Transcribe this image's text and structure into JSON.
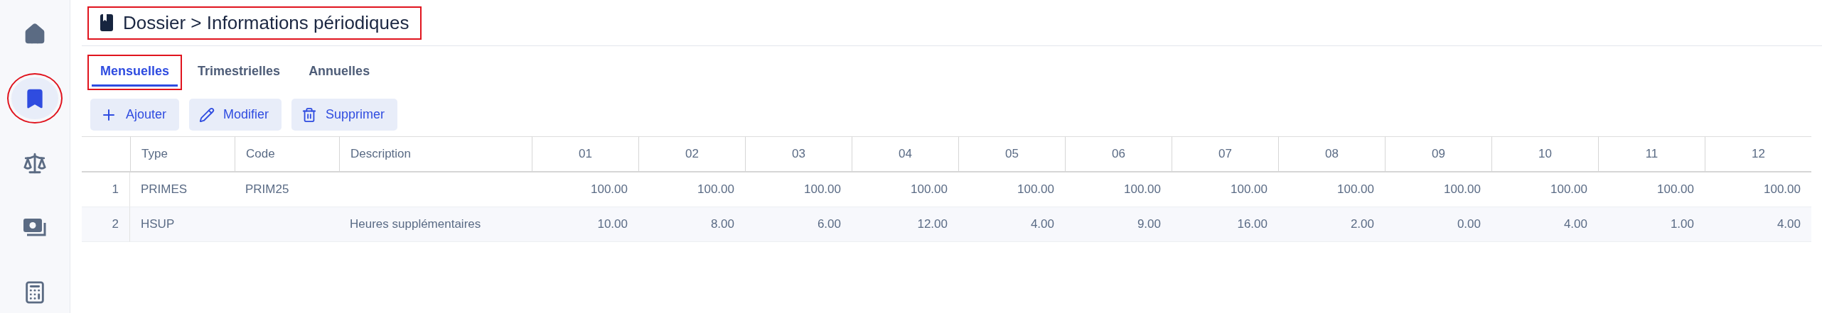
{
  "sidebar": {
    "items": [
      {
        "kind": "home",
        "selected": false,
        "annotated": false
      },
      {
        "kind": "book",
        "selected": true,
        "annotated": true
      },
      {
        "kind": "scale",
        "selected": false,
        "annotated": false
      },
      {
        "kind": "money",
        "selected": false,
        "annotated": false
      },
      {
        "kind": "calculator",
        "selected": false,
        "annotated": false
      }
    ]
  },
  "header": {
    "title": "Dossier > Informations périodiques",
    "annotated": true
  },
  "tabs": [
    {
      "label": "Mensuelles",
      "selected": true,
      "annotated": true
    },
    {
      "label": "Trimestrielles",
      "selected": false,
      "annotated": false
    },
    {
      "label": "Annuelles",
      "selected": false,
      "annotated": false
    }
  ],
  "toolbar": [
    {
      "kind": "add",
      "label": "Ajouter"
    },
    {
      "kind": "edit",
      "label": "Modifier"
    },
    {
      "kind": "delete",
      "label": "Supprimer"
    }
  ],
  "table": {
    "columns": [
      "Type",
      "Code",
      "Description",
      "01",
      "02",
      "03",
      "04",
      "05",
      "06",
      "07",
      "08",
      "09",
      "10",
      "11",
      "12"
    ],
    "rows": [
      {
        "number": "1",
        "cells": [
          "PRIMES",
          "PRIM25",
          "",
          "100.00",
          "100.00",
          "100.00",
          "100.00",
          "100.00",
          "100.00",
          "100.00",
          "100.00",
          "100.00",
          "100.00",
          "100.00",
          "100.00"
        ]
      },
      {
        "number": "2",
        "cells": [
          "HSUP",
          "",
          "Heures supplémentaires",
          "10.00",
          "8.00",
          "6.00",
          "12.00",
          "4.00",
          "9.00",
          "16.00",
          "2.00",
          "0.00",
          "4.00",
          "1.00",
          "4.00"
        ]
      }
    ]
  }
}
